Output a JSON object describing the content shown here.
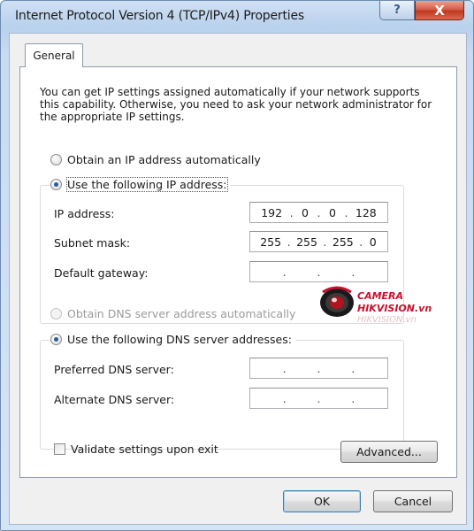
{
  "window": {
    "title": "Internet Protocol Version 4 (TCP/IPv4) Properties",
    "help_glyph": "?",
    "close_glyph": "X"
  },
  "tabs": [
    {
      "label": "General",
      "selected": true
    }
  ],
  "intro_text": "You can get IP settings assigned automatically if your network supports this capability. Otherwise, you need to ask your network administrator for the appropriate IP settings.",
  "ip_mode": {
    "auto_label": "Obtain an IP address automatically",
    "manual_label": "Use the following IP address:",
    "selected": "manual"
  },
  "ip_fields": [
    {
      "label": "IP address:",
      "octets": [
        "192",
        "0",
        "0",
        "128"
      ]
    },
    {
      "label": "Subnet mask:",
      "octets": [
        "255",
        "255",
        "255",
        "0"
      ]
    },
    {
      "label": "Default gateway:",
      "octets": [
        "",
        "",
        "",
        ""
      ]
    }
  ],
  "dns_mode": {
    "auto_label": "Obtain DNS server address automatically",
    "manual_label": "Use the following DNS server addresses:",
    "selected": "manual"
  },
  "dns_fields": [
    {
      "label": "Preferred DNS server:",
      "octets": [
        "",
        "",
        "",
        ""
      ]
    },
    {
      "label": "Alternate DNS server:",
      "octets": [
        "",
        "",
        "",
        ""
      ]
    }
  ],
  "validate": {
    "label": "Validate settings upon exit",
    "checked": false
  },
  "buttons": {
    "advanced": "Advanced...",
    "ok": "OK",
    "cancel": "Cancel"
  },
  "watermark": {
    "line1": "CAMERA",
    "line2": "HIKVISION.vn",
    "line3": "HIKVISION.vn"
  },
  "colors": {
    "title_bar": "#c8dbf1",
    "close_button": "#c0381f",
    "radio_dot": "#2a5d9c",
    "watermark_red": "#c8102e"
  }
}
